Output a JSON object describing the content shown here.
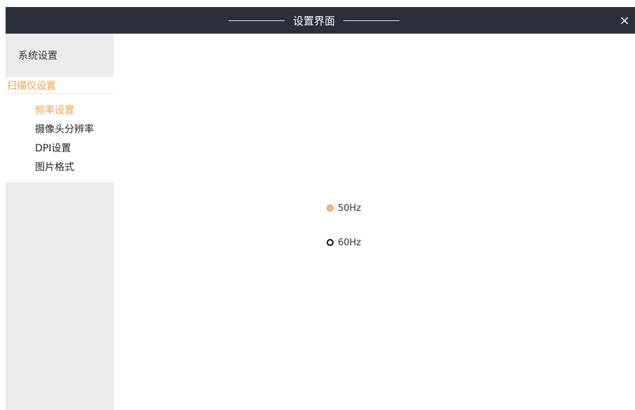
{
  "window": {
    "title": "设置界面",
    "close_glyph": "×"
  },
  "sidebar": {
    "system_settings": "系统设置",
    "scanner_settings": "扫描仪设置",
    "sub_items": [
      {
        "label": "频率设置",
        "active": true
      },
      {
        "label": "摄像头分辨率",
        "active": false
      },
      {
        "label": "DPI设置",
        "active": false
      },
      {
        "label": "图片格式",
        "active": false
      }
    ]
  },
  "frequency": {
    "options": [
      {
        "label": "50Hz",
        "selected": true
      },
      {
        "label": "60Hz",
        "selected": false
      }
    ]
  },
  "colors": {
    "titlebar": "#2b2f3a",
    "accent": "#f0a04b",
    "sidebar_bg": "#ebebed"
  },
  "icons": {
    "close": "close-icon",
    "radio_checked": "radio-checked-icon",
    "radio_unchecked": "radio-unchecked-icon"
  }
}
